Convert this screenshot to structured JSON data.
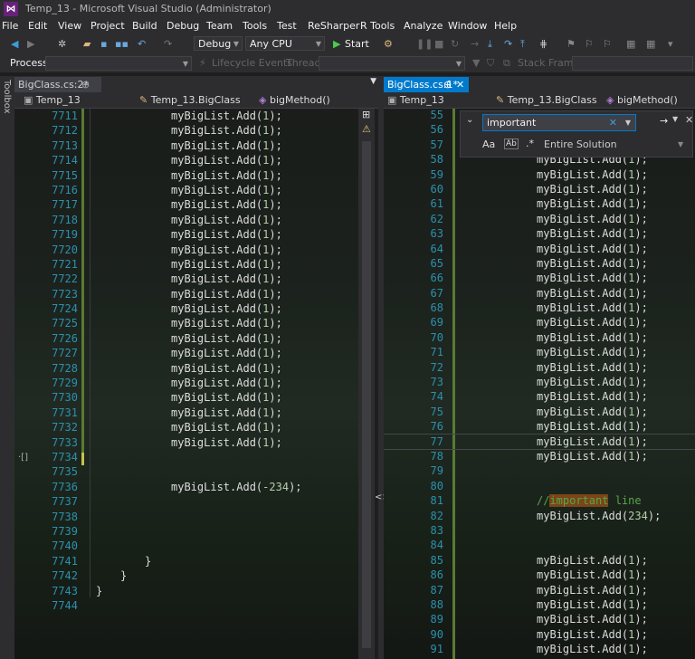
{
  "window": {
    "title": "Temp_13 - Microsoft Visual Studio  (Administrator)"
  },
  "menu": [
    "File",
    "Edit",
    "View",
    "Project",
    "Build",
    "Debug",
    "Team",
    "Tools",
    "Test",
    "ReSharper",
    "R Tools",
    "Analyze",
    "Window",
    "Help"
  ],
  "toolbar": {
    "config": "Debug",
    "platform": "Any CPU",
    "start_label": "Start"
  },
  "process_bar": {
    "process_label": "Process:",
    "lifecycle_label": "Lifecycle Events",
    "thread_label": "Thread:",
    "stack_label": "Stack Frame:"
  },
  "toolbox_label": "Toolbox",
  "left_pane": {
    "tab": "BigClass.cs:2*",
    "nav": {
      "project": "Temp_13",
      "class": "Temp_13.BigClass",
      "method": "bigMethod()"
    },
    "lines": [
      {
        "n": "7711",
        "code": "myBigList.Add(1);"
      },
      {
        "n": "7712",
        "code": "myBigList.Add(1);"
      },
      {
        "n": "7713",
        "code": "myBigList.Add(1);"
      },
      {
        "n": "7714",
        "code": "myBigList.Add(1);"
      },
      {
        "n": "7715",
        "code": "myBigList.Add(1);"
      },
      {
        "n": "7716",
        "code": "myBigList.Add(1);"
      },
      {
        "n": "7717",
        "code": "myBigList.Add(1);"
      },
      {
        "n": "7718",
        "code": "myBigList.Add(1);"
      },
      {
        "n": "7719",
        "code": "myBigList.Add(1);"
      },
      {
        "n": "7720",
        "code": "myBigList.Add(1);"
      },
      {
        "n": "7721",
        "code": "myBigList.Add(1);"
      },
      {
        "n": "7722",
        "code": "myBigList.Add(1);"
      },
      {
        "n": "7723",
        "code": "myBigList.Add(1);"
      },
      {
        "n": "7724",
        "code": "myBigList.Add(1);"
      },
      {
        "n": "7725",
        "code": "myBigList.Add(1);"
      },
      {
        "n": "7726",
        "code": "myBigList.Add(1);"
      },
      {
        "n": "7727",
        "code": "myBigList.Add(1);"
      },
      {
        "n": "7728",
        "code": "myBigList.Add(1);"
      },
      {
        "n": "7729",
        "code": "myBigList.Add(1);"
      },
      {
        "n": "7730",
        "code": "myBigList.Add(1);"
      },
      {
        "n": "7731",
        "code": "myBigList.Add(1);"
      },
      {
        "n": "7732",
        "code": "myBigList.Add(1);"
      },
      {
        "n": "7733",
        "code": "myBigList.Add(1);"
      },
      {
        "n": "7734",
        "code": ""
      },
      {
        "n": "7735",
        "code": ""
      },
      {
        "n": "7736",
        "code": "myBigList.Add(-234);"
      },
      {
        "n": "7737",
        "code": ""
      },
      {
        "n": "7738",
        "code": ""
      },
      {
        "n": "7739",
        "code": ""
      },
      {
        "n": "7740",
        "code": ""
      },
      {
        "n": "7741",
        "code": "}"
      },
      {
        "n": "7742",
        "code": "}"
      },
      {
        "n": "7743",
        "code": "}"
      },
      {
        "n": "7744",
        "code": ""
      }
    ]
  },
  "right_pane": {
    "tab": "BigClass.cs:1*",
    "nav": {
      "project": "Temp_13",
      "class": "Temp_13.BigClass",
      "method": "bigMethod()"
    },
    "find": {
      "query": "important",
      "scope": "Entire Solution"
    },
    "lines": [
      {
        "n": "55",
        "code": ""
      },
      {
        "n": "56",
        "code": ""
      },
      {
        "n": "57",
        "code": ""
      },
      {
        "n": "58",
        "code": "myBigList.Add(1);"
      },
      {
        "n": "59",
        "code": "myBigList.Add(1);"
      },
      {
        "n": "60",
        "code": "myBigList.Add(1);"
      },
      {
        "n": "61",
        "code": "myBigList.Add(1);"
      },
      {
        "n": "62",
        "code": "myBigList.Add(1);"
      },
      {
        "n": "63",
        "code": "myBigList.Add(1);"
      },
      {
        "n": "64",
        "code": "myBigList.Add(1);"
      },
      {
        "n": "65",
        "code": "myBigList.Add(1);"
      },
      {
        "n": "66",
        "code": "myBigList.Add(1);"
      },
      {
        "n": "67",
        "code": "myBigList.Add(1);"
      },
      {
        "n": "68",
        "code": "myBigList.Add(1);"
      },
      {
        "n": "69",
        "code": "myBigList.Add(1);"
      },
      {
        "n": "70",
        "code": "myBigList.Add(1);"
      },
      {
        "n": "71",
        "code": "myBigList.Add(1);"
      },
      {
        "n": "72",
        "code": "myBigList.Add(1);"
      },
      {
        "n": "73",
        "code": "myBigList.Add(1);"
      },
      {
        "n": "74",
        "code": "myBigList.Add(1);"
      },
      {
        "n": "75",
        "code": "myBigList.Add(1);"
      },
      {
        "n": "76",
        "code": "myBigList.Add(1);"
      },
      {
        "n": "77",
        "code": "myBigList.Add(1);"
      },
      {
        "n": "78",
        "code": "myBigList.Add(1);"
      },
      {
        "n": "79",
        "code": ""
      },
      {
        "n": "80",
        "code": ""
      },
      {
        "n": "81",
        "code": "//important line"
      },
      {
        "n": "82",
        "code": "myBigList.Add(234);"
      },
      {
        "n": "83",
        "code": ""
      },
      {
        "n": "84",
        "code": ""
      },
      {
        "n": "85",
        "code": "myBigList.Add(1);"
      },
      {
        "n": "86",
        "code": "myBigList.Add(1);"
      },
      {
        "n": "87",
        "code": "myBigList.Add(1);"
      },
      {
        "n": "88",
        "code": "myBigList.Add(1);"
      },
      {
        "n": "89",
        "code": "myBigList.Add(1);"
      },
      {
        "n": "90",
        "code": "myBigList.Add(1);"
      },
      {
        "n": "91",
        "code": "myBigList.Add(1);"
      }
    ]
  },
  "colors": {
    "accent": "#007acc",
    "line_number": "#2b91af",
    "number": "#b5cea8",
    "comment": "#57a64a",
    "find_highlight": "#7a4517",
    "change_bar": "#5a7a33"
  }
}
